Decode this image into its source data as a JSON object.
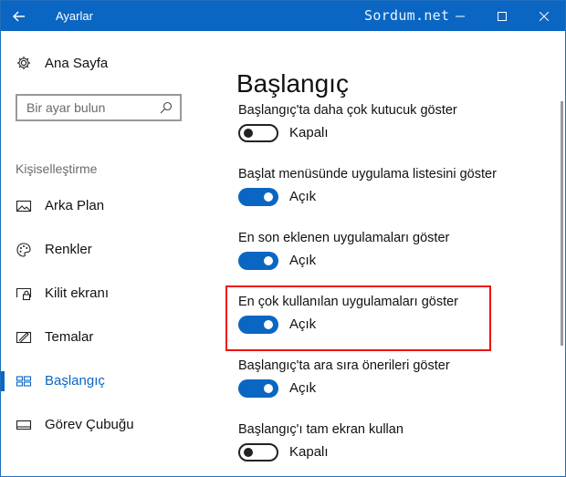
{
  "window": {
    "title": "Ayarlar",
    "watermark": "Sordum.net",
    "accent": "#0a66c2"
  },
  "sidebar": {
    "home_label": "Ana Sayfa",
    "search_placeholder": "Bir ayar bulun",
    "section_title": "Kişiselleştirme",
    "items": [
      {
        "label": "Arka Plan",
        "icon": "picture-icon",
        "active": false
      },
      {
        "label": "Renkler",
        "icon": "palette-icon",
        "active": false
      },
      {
        "label": "Kilit ekranı",
        "icon": "lock-screen-icon",
        "active": false
      },
      {
        "label": "Temalar",
        "icon": "themes-icon",
        "active": false
      },
      {
        "label": "Başlangıç",
        "icon": "start-icon",
        "active": true
      },
      {
        "label": "Görev Çubuğu",
        "icon": "taskbar-icon",
        "active": false
      }
    ]
  },
  "main": {
    "title": "Başlangıç",
    "settings": [
      {
        "label": "Başlangıç'ta daha çok kutucuk göster",
        "state": "Kapalı",
        "on": false
      },
      {
        "label": "Başlat menüsünde uygulama listesini göster",
        "state": "Açık",
        "on": true
      },
      {
        "label": "En son eklenen uygulamaları göster",
        "state": "Açık",
        "on": true
      },
      {
        "label": "En çok kullanılan uygulamaları göster",
        "state": "Açık",
        "on": true
      },
      {
        "label": "Başlangıç'ta ara sıra önerileri göster",
        "state": "Açık",
        "on": true
      },
      {
        "label": "Başlangıç'ı tam ekran kullan",
        "state": "Kapalı",
        "on": false
      }
    ]
  }
}
